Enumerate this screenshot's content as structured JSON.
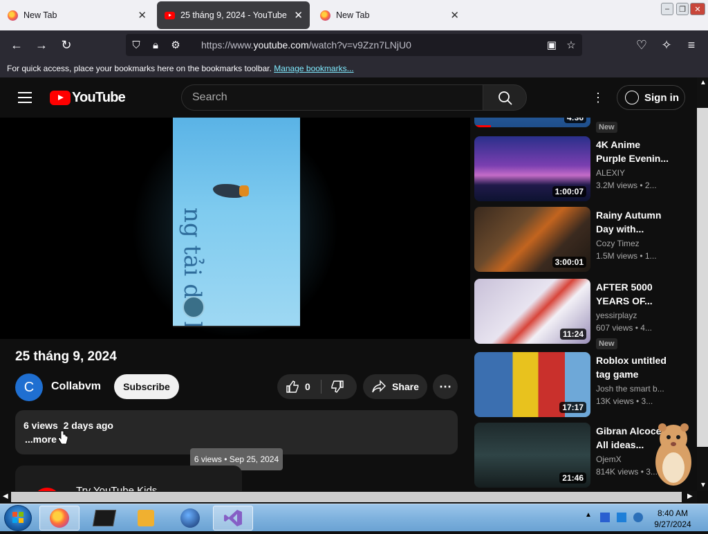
{
  "browser": {
    "tabs": [
      {
        "label": "New Tab"
      },
      {
        "label": "25 tháng 9, 2024 - YouTube"
      },
      {
        "label": "New Tab"
      }
    ],
    "url_prefix": "https://www.",
    "url_domain": "youtube.com",
    "url_path": "/watch?v=v9Zzn7LNjU0",
    "bookmarks_text": "For quick access, place your bookmarks here on the bookmarks toolbar.",
    "bookmarks_link": "Manage bookmarks..."
  },
  "youtube": {
    "logo_text": "YouTube",
    "search_placeholder": "Search",
    "sign_in": "Sign in"
  },
  "video": {
    "overlay_text": "ng tải dữ liệu...",
    "title": "25 tháng 9, 2024",
    "channel_initial": "C",
    "channel": "Collabvm",
    "subscribe": "Subscribe",
    "likes": "0",
    "share": "Share",
    "views": "6 views",
    "age": "2 days ago",
    "more": "...more",
    "tooltip": "6 views • Sep 25, 2024",
    "kids_text": "Try YouTube Kids"
  },
  "related": [
    {
      "title": "",
      "channel": "",
      "stats": "",
      "duration": "4:36",
      "badge": "New"
    },
    {
      "title": "4K Anime Purple Evenin...",
      "channel": "ALEXIY",
      "stats": "3.2M views  • 2...",
      "duration": "1:00:07",
      "badge": ""
    },
    {
      "title": "Rainy Autumn Day with...",
      "channel": "Cozy Timez",
      "stats": "1.5M views  • 1...",
      "duration": "3:00:01",
      "badge": ""
    },
    {
      "title": "AFTER 5000 YEARS OF...",
      "channel": "yessirplayz",
      "stats": "607 views  • 4...",
      "duration": "11:24",
      "badge": "New"
    },
    {
      "title": "Roblox untitled tag game",
      "channel": "Josh the smart b...",
      "stats": "13K views  • 3...",
      "duration": "17:17",
      "badge": ""
    },
    {
      "title": "Gibran Alcoce - All ideas...",
      "channel": "OjemX",
      "stats": "814K views  • 3...",
      "duration": "21:46",
      "badge": ""
    }
  ],
  "taskbar": {
    "time": "8:40 AM",
    "date": "9/27/2024"
  }
}
